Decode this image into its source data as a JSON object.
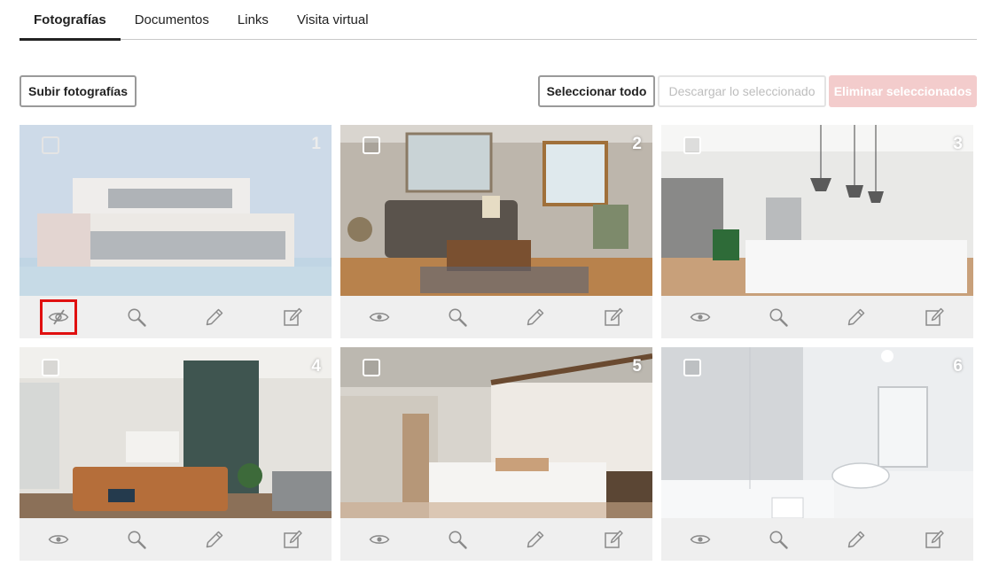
{
  "tabs": [
    {
      "label": "Fotografías",
      "active": true
    },
    {
      "label": "Documentos",
      "active": false
    },
    {
      "label": "Links",
      "active": false
    },
    {
      "label": "Visita virtual",
      "active": false
    }
  ],
  "toolbar": {
    "upload_label": "Subir fotografías",
    "select_all_label": "Seleccionar todo",
    "download_label": "Descargar lo seleccionado",
    "delete_label": "Eliminar seleccionados"
  },
  "photos": [
    {
      "number": "1",
      "hidden": true
    },
    {
      "number": "2",
      "hidden": false
    },
    {
      "number": "3",
      "hidden": false
    },
    {
      "number": "4",
      "hidden": false
    },
    {
      "number": "5",
      "hidden": false
    },
    {
      "number": "6",
      "hidden": false
    }
  ],
  "icons": {
    "visibility_hidden": "eye-slash-icon",
    "visibility": "eye-icon",
    "zoom": "magnifier-icon",
    "edit": "pencil-icon",
    "edit_details": "edit-box-icon"
  },
  "colors": {
    "delete_button_bg": "#f3cccc",
    "highlight_border": "#e01010",
    "action_bar_bg": "#efefef"
  }
}
